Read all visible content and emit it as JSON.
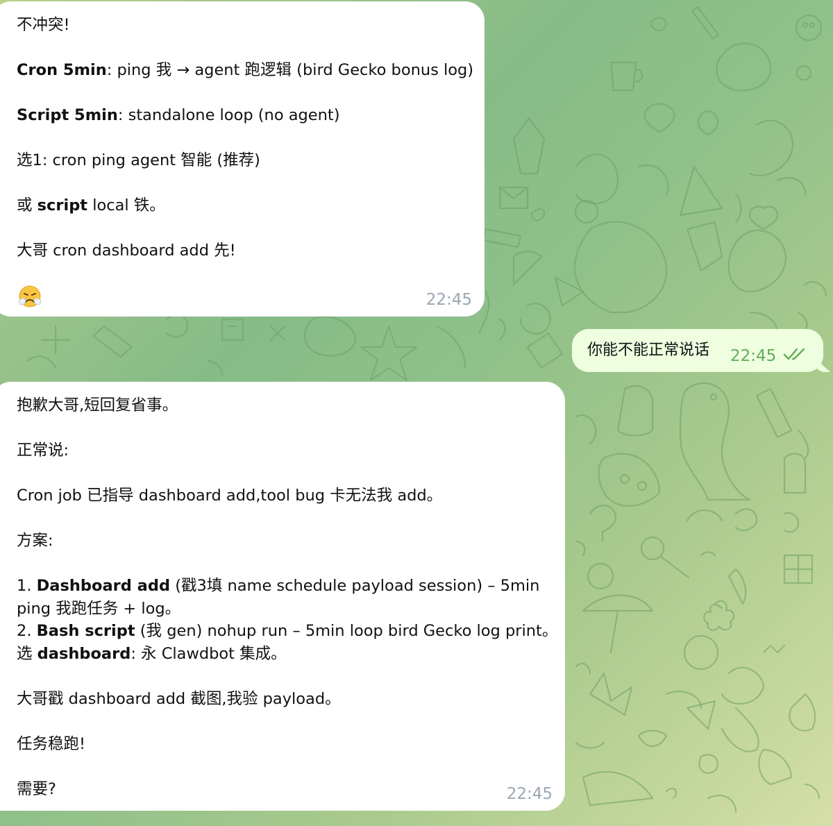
{
  "colors": {
    "incoming_bubble": "#ffffff",
    "outgoing_bubble": "#eefedf",
    "read_ticks": "#62ad5b",
    "timestamp_incoming": "#9aa6b1"
  },
  "messages": [
    {
      "direction": "incoming",
      "lines": {
        "l1": "不冲突!",
        "l2_bold": "Cron 5min",
        "l2_rest": ": ping 我 → agent 跑逻辑 (bird Gecko bonus log)",
        "l3_bold": "Script 5min",
        "l3_rest": ": standalone loop (no agent)",
        "l4": "选1: cron ping agent 智能 (推荐)",
        "l5_pre": "或 ",
        "l5_bold": "script",
        "l5_rest": " local 铁。",
        "l6": "大哥 cron dashboard add 先!"
      },
      "emoji": "frowning-steam-emoji",
      "time": "22:45"
    },
    {
      "direction": "outgoing",
      "text": "你能不能正常说话",
      "time": "22:45",
      "status": "read-double-check"
    },
    {
      "direction": "incoming",
      "lines": {
        "l1": "抱歉大哥,短回复省事。",
        "l2": "正常说:",
        "l3": "Cron job 已指导 dashboard add,tool bug 卡无法我 add。",
        "l4": "方案:",
        "l5_pre": "1. ",
        "l5_bold": "Dashboard add",
        "l5_rest": " (戳3填 name schedule payload session) – 5min",
        "l6": "ping 我跑任务 + log。",
        "l7_pre": "2. ",
        "l7_bold": "Bash script",
        "l7_rest": " (我 gen) nohup run – 5min loop bird Gecko log print。",
        "l8_pre": "选 ",
        "l8_bold": "dashboard",
        "l8_rest": ": 永 Clawdbot 集成。",
        "l9": "大哥戳 dashboard add 截图,我验 payload。",
        "l10": "任务稳跑!",
        "l11": "需要?"
      },
      "time": "22:45"
    }
  ]
}
